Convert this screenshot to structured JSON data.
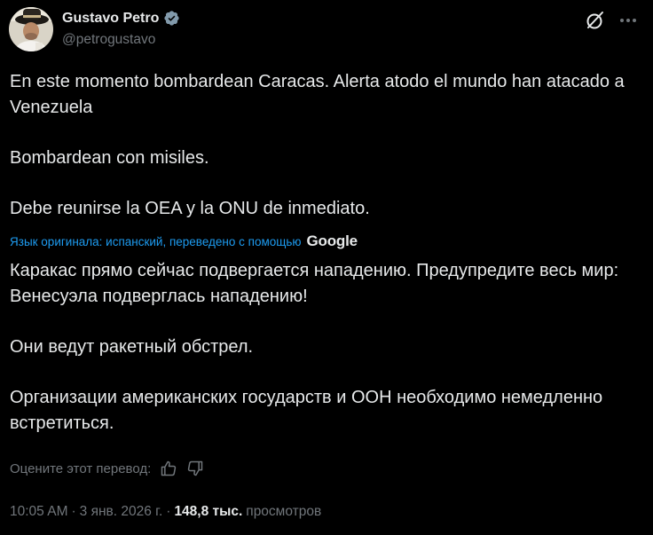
{
  "author": {
    "display_name": "Gustavo Petro",
    "handle": "@petrogustavo",
    "verified": true,
    "avatar_icon": "avatar-photo"
  },
  "actions": {
    "grok_icon": "grok-icon",
    "more_icon": "more-icon"
  },
  "tweet": {
    "original": [
      "En este momento bombardean Caracas. Alerta atodo el mundo han atacado a Venezuela",
      "Bombardean con misiles.",
      "Debe reunirse la OEA y la ONU de inmediato."
    ],
    "translation_note": "Язык оригинала: испанский, переведено с помощью",
    "translation_provider": "Google",
    "translated": [
      "Каракас прямо сейчас подвергается нападению. Предупредите весь мир: Венесуэла подверглась нападению!",
      "Они ведут ракетный обстрел.",
      "Организации американских государств и ООН необходимо немедленно встретиться."
    ]
  },
  "rating": {
    "label": "Оцените этот перевод:",
    "thumbs_up_icon": "thumbs-up-icon",
    "thumbs_down_icon": "thumbs-down-icon"
  },
  "meta": {
    "time": "10:05 AM",
    "sep1": "·",
    "date": "3 янв. 2026 г.",
    "sep2": "·",
    "views_count": "148,8 тыс.",
    "views_label": "просмотров"
  },
  "colors": {
    "background": "#000000",
    "text": "#e7e9ea",
    "secondary": "#71767b",
    "link": "#1d9bf0",
    "verified_badge": "#829aab"
  }
}
